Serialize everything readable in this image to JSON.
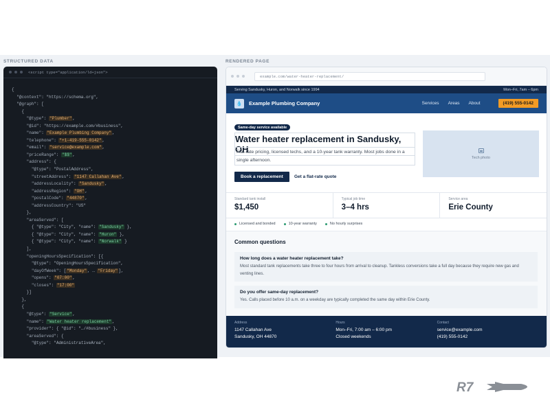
{
  "labels": {
    "structured": "STRUCTURED DATA",
    "rendered": "RENDERED PAGE"
  },
  "code": {
    "header": "<script type=\"application/ld+json\">"
  },
  "browser": {
    "url": "example.com/water-heater-replacement/"
  },
  "site": {
    "topbar_left": "Serving Sandusky, Huron, and Norwalk since 1994",
    "topbar_right": "Mon–Fri, 7am – 6pm",
    "logo_glyph": "💧",
    "brand": "Example Plumbing Company",
    "nav": [
      "Services",
      "Areas",
      "About"
    ],
    "phone_cta": "(419) 555-0142"
  },
  "hero": {
    "badge": "Same-day service available",
    "title": "Water heater replacement in Sandusky, OH",
    "subtitle": "Flat-rate pricing, licensed techs, and a 10-year tank warranty. Most jobs done in a single afternoon.",
    "primary_button": "Book a replacement",
    "secondary_link": "Get a flat-rate quote",
    "photo_label": "Tech photo"
  },
  "stats": [
    {
      "label": "Standard tank install",
      "value": "$1,450"
    },
    {
      "label": "Typical job time",
      "value": "3–4 hrs"
    },
    {
      "label": "Service area",
      "value": "Erie County"
    }
  ],
  "features": [
    "Licensed and bonded",
    "10-year warranty",
    "No hourly surprises"
  ],
  "faq": {
    "title": "Common questions",
    "items": [
      {
        "q": "How long does a water heater replacement take?",
        "a": "Most standard tank replacements take three to four hours from arrival to cleanup. Tankless conversions take a full day because they require new gas and venting lines."
      },
      {
        "q": "Do you offer same-day replacement?",
        "a": "Yes. Calls placed before 10 a.m. on a weekday are typically completed the same day within Erie County."
      }
    ]
  },
  "footer": {
    "address_label": "Address",
    "address_1": "1147 Callahan Ave",
    "address_2": "Sandusky, OH 44870",
    "hours_label": "Hours",
    "hours_1": "Mon–Fri, 7:00 am – 6:00 pm",
    "hours_2": "Closed weekends",
    "contact_label": "Contact",
    "contact_1": "service@example.com",
    "contact_2": "(419) 555-0142"
  },
  "watermark": "R7",
  "colors": {
    "navy": "#12294a",
    "nav_blue": "#1e4d86",
    "accent": "#f29b25"
  }
}
